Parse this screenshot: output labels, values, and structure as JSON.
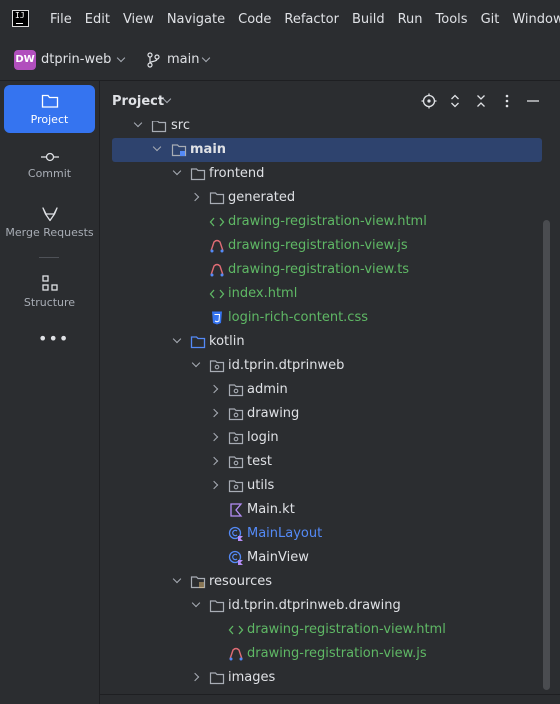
{
  "menu": {
    "items": [
      "File",
      "Edit",
      "View",
      "Navigate",
      "Code",
      "Refactor",
      "Build",
      "Run",
      "Tools",
      "Git",
      "Window"
    ]
  },
  "toolbar": {
    "project_badge": "DW",
    "project_name": "dtprin-web",
    "branch_name": "main"
  },
  "toolstrip": {
    "project_label": "Project",
    "commit_label": "Commit",
    "merge_requests_label": "Merge Requests",
    "structure_label": "Structure",
    "more_label": "•••"
  },
  "panel": {
    "title": "Project"
  },
  "tree": {
    "rows": [
      {
        "label": "src"
      },
      {
        "label": "main"
      },
      {
        "label": "frontend"
      },
      {
        "label": "generated"
      },
      {
        "label": "drawing-registration-view.html"
      },
      {
        "label": "drawing-registration-view.js"
      },
      {
        "label": "drawing-registration-view.ts"
      },
      {
        "label": "index.html"
      },
      {
        "label": "login-rich-content.css"
      },
      {
        "label": "kotlin"
      },
      {
        "label": "id.tprin.dtprinweb"
      },
      {
        "label": "admin"
      },
      {
        "label": "drawing"
      },
      {
        "label": "login"
      },
      {
        "label": "test"
      },
      {
        "label": "utils"
      },
      {
        "label": "Main.kt"
      },
      {
        "label": "MainLayout"
      },
      {
        "label": "MainView"
      },
      {
        "label": "resources"
      },
      {
        "label": "id.tprin.dtprinweb.drawing"
      },
      {
        "label": "drawing-registration-view.html"
      },
      {
        "label": "drawing-registration-view.js"
      },
      {
        "label": "images"
      }
    ]
  },
  "colors": {
    "accent": "#3574f0",
    "selection": "#2e436e",
    "modified_green": "#5fb865",
    "kotlin_class_blue": "#548af7",
    "panel_bg": "#2b2d30"
  }
}
